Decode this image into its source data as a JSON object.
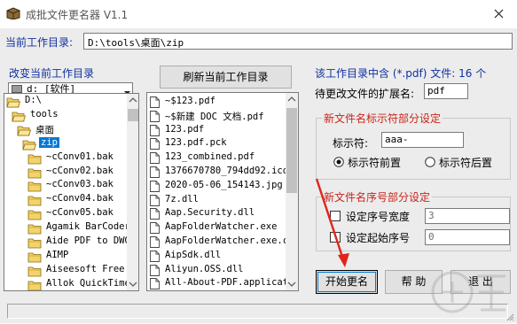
{
  "window": {
    "title": "成批文件更名器 V1.1"
  },
  "path_row": {
    "label": "当前工作目录:",
    "value": "D:\\tools\\桌面\\zip"
  },
  "left_panel": {
    "change_dir_label": "改变当前工作目录",
    "drive": "d: [软件]",
    "tree": [
      {
        "label": "D:\\",
        "indent": 0,
        "selected": false
      },
      {
        "label": "tools",
        "indent": 1,
        "selected": false
      },
      {
        "label": "桌面",
        "indent": 2,
        "selected": false
      },
      {
        "label": "zip",
        "indent": 3,
        "selected": true
      },
      {
        "label": "~cConv01.bak",
        "indent": 4,
        "selected": false
      },
      {
        "label": "~cConv02.bak",
        "indent": 4,
        "selected": false
      },
      {
        "label": "~cConv03.bak",
        "indent": 4,
        "selected": false
      },
      {
        "label": "~cConv04.bak",
        "indent": 4,
        "selected": false
      },
      {
        "label": "~cConv05.bak",
        "indent": 4,
        "selected": false
      },
      {
        "label": "Agamik BarCoder",
        "indent": 4,
        "selected": false
      },
      {
        "label": "Aide PDF to DWG C",
        "indent": 4,
        "selected": false
      },
      {
        "label": "AIMP",
        "indent": 4,
        "selected": false
      },
      {
        "label": "Aiseesoft Free Vi",
        "indent": 4,
        "selected": false
      },
      {
        "label": "Allok QuickTime t",
        "indent": 4,
        "selected": false
      }
    ]
  },
  "middle_panel": {
    "refresh_label": "刷新当前工作目录",
    "files": [
      "~$123.pdf",
      "~$新建 DOC 文档.pdf",
      "123.pdf",
      "123.pdf.pck",
      "123_combined.pdf",
      "1376670780_794dd92.ico",
      "2020-05-06_154143.jpg",
      "7z.dll",
      "Aap.Security.dll",
      "AapFolderWatcher.exe",
      "AapFolderWatcher.exe.co",
      "AipSdk.dll",
      "Aliyun.OSS.dll",
      "All-About-PDF.applicati"
    ]
  },
  "right_panel": {
    "info_label": "该工作目录中含 (*.pdf) 文件: 16 个",
    "ext_label": "待更改文件的扩展名:",
    "ext_value": "pdf",
    "tag_group": {
      "title": "新文件名标示符部分设定",
      "tag_label": "标示符:",
      "tag_value": "aaa-",
      "radio_front": "标示符前置",
      "radio_back": "标示符后置",
      "front_selected": true
    },
    "seq_group": {
      "title": "新文件名序号部分设定",
      "width_label": "设定序号宽度",
      "width_value": "3",
      "start_label": "设定起始序号",
      "start_value": "0"
    },
    "buttons": {
      "start": "开始更名",
      "help": "帮 助",
      "exit": "退 出"
    }
  },
  "colors": {
    "blue_label": "#1030a0",
    "red_label": "#c8241a",
    "selection": "#0078d7",
    "annotation_arrow": "#e0241a"
  }
}
